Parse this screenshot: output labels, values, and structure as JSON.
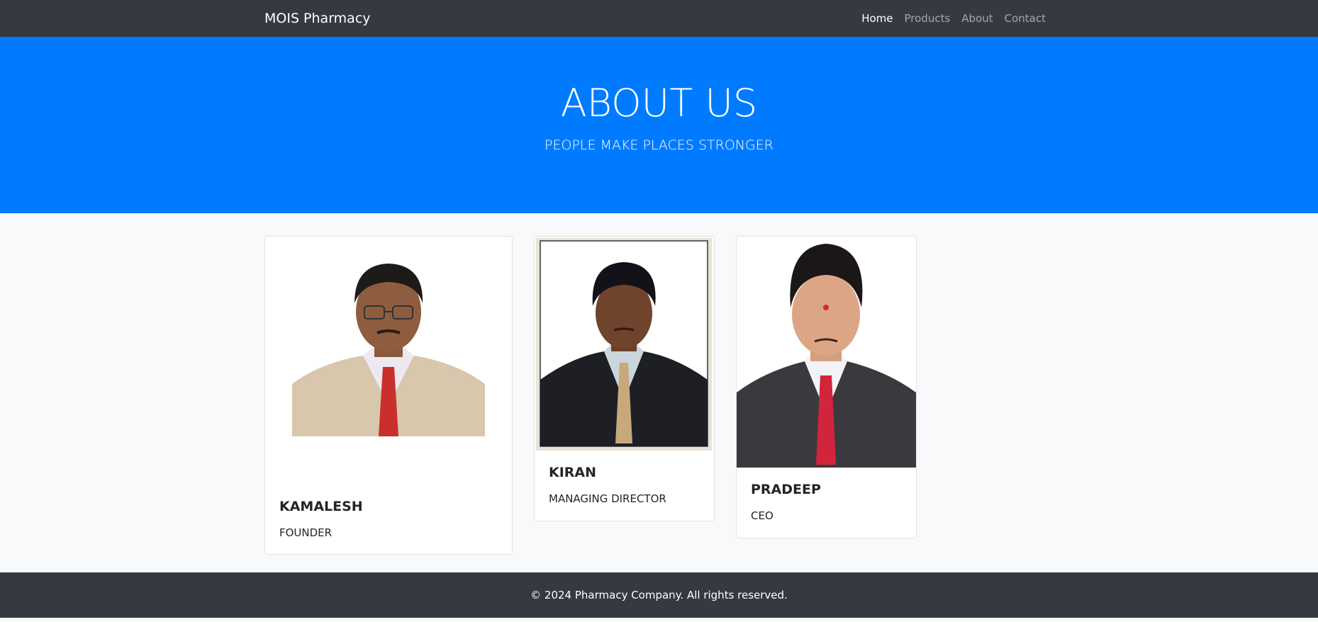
{
  "navbar": {
    "brand": "MOIS Pharmacy",
    "links": [
      {
        "label": "Home"
      },
      {
        "label": "Products"
      },
      {
        "label": "About"
      },
      {
        "label": "Contact"
      }
    ]
  },
  "hero": {
    "title": "ABOUT US",
    "subtitle": "PEOPLE MAKE PLACES STRONGER"
  },
  "team": [
    {
      "name": "KAMALESH",
      "role": "FOUNDER"
    },
    {
      "name": "KIRAN",
      "role": "MANAGING DIRECTOR"
    },
    {
      "name": "PRADEEP",
      "role": "CEO"
    }
  ],
  "footer": {
    "text": "© 2024 Pharmacy Company. All rights reserved."
  },
  "colors": {
    "navbar_bg": "#343a40",
    "hero_bg": "#007bff",
    "page_bg": "#f8f9fa"
  }
}
